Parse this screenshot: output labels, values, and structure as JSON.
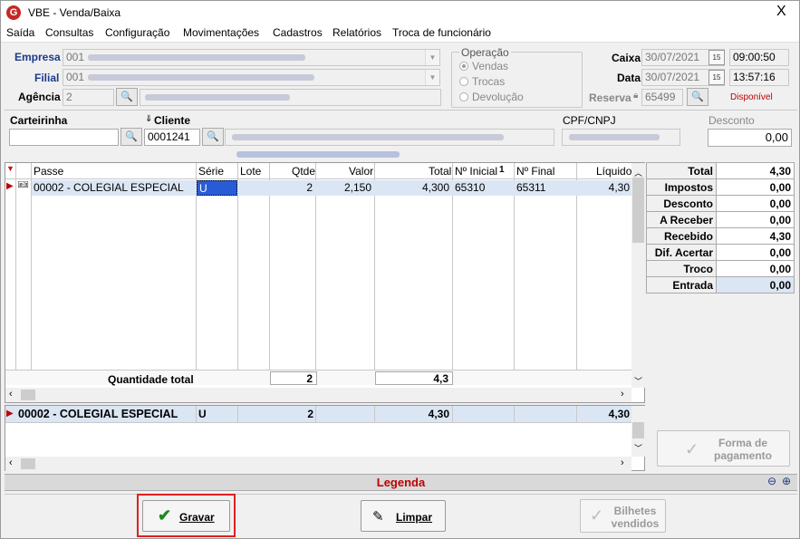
{
  "window": {
    "title": "VBE - Venda/Baixa",
    "close_label": "X"
  },
  "menu": [
    "Saída",
    "Consultas",
    "Configuração",
    "Movimentações",
    "Cadastros",
    "Relatórios",
    "Troca de funcionário"
  ],
  "form": {
    "empresa_label": "Empresa",
    "empresa_code": "001",
    "filial_label": "Filial",
    "filial_code": "001",
    "agencia_label": "Agência",
    "agencia_code": "2",
    "operacao_label": "Operação",
    "operacao_options": [
      "Vendas",
      "Trocas",
      "Devolução"
    ],
    "caixa_label": "Caixa",
    "caixa_date": "30/07/2021",
    "caixa_time": "09:00:50",
    "data_label": "Data",
    "data_date": "30/07/2021",
    "data_time": "13:57:16",
    "reserva_label": "Reserva",
    "reserva_value": "65499",
    "reserva_status": "Disponível",
    "calendar_label": "15",
    "carteirinha_label": "Carteirinha",
    "carteirinha_value": "",
    "cliente_label": "Cliente",
    "cliente_value": "0001241",
    "cpf_label": "CPF/CNPJ",
    "desconto_label": "Desconto",
    "desconto_value": "0,00"
  },
  "grid": {
    "columns": [
      "Passe",
      "Série",
      "Lote",
      "Qtde",
      "Valor",
      "Total",
      "Nº Inicial",
      "Nº Final",
      "Líquido"
    ],
    "sort_indicator": "1",
    "rows": [
      {
        "passe": "00002 - COLEGIAL ESPECIAL",
        "serie": "U",
        "lote": "",
        "qtde": "2",
        "valor": "2,150",
        "total": "4,300",
        "inicial": "65310",
        "final": "65311",
        "liquido": "4,30"
      }
    ],
    "footer_label": "Quantidade total",
    "footer_qtde": "2",
    "footer_total": "4,3"
  },
  "grid2": {
    "rows": [
      {
        "passe": "00002 - COLEGIAL ESPECIAL",
        "serie": "U",
        "qtde": "2",
        "total": "4,30",
        "liquido": "4,30"
      }
    ]
  },
  "summary": [
    {
      "label": "Total",
      "value": "4,30"
    },
    {
      "label": "Impostos",
      "value": "0,00"
    },
    {
      "label": "Desconto",
      "value": "0,00"
    },
    {
      "label": "A Receber",
      "value": "0,00"
    },
    {
      "label": "Recebido",
      "value": "4,30"
    },
    {
      "label": "Dif. Acertar",
      "value": "0,00"
    },
    {
      "label": "Troco",
      "value": "0,00"
    },
    {
      "label": "Entrada",
      "value": "0,00"
    }
  ],
  "buttons": {
    "forma_pagamento": "Forma de pagamento",
    "gravar": "Gravar",
    "limpar": "Limpar",
    "bilhetes": "Bilhetes vendidos"
  },
  "legenda": "Legenda",
  "colors": {
    "accent": "#1a3a8a",
    "danger": "#c00000",
    "highlight": "#e02020",
    "selected_row": "#dbe6f4"
  }
}
